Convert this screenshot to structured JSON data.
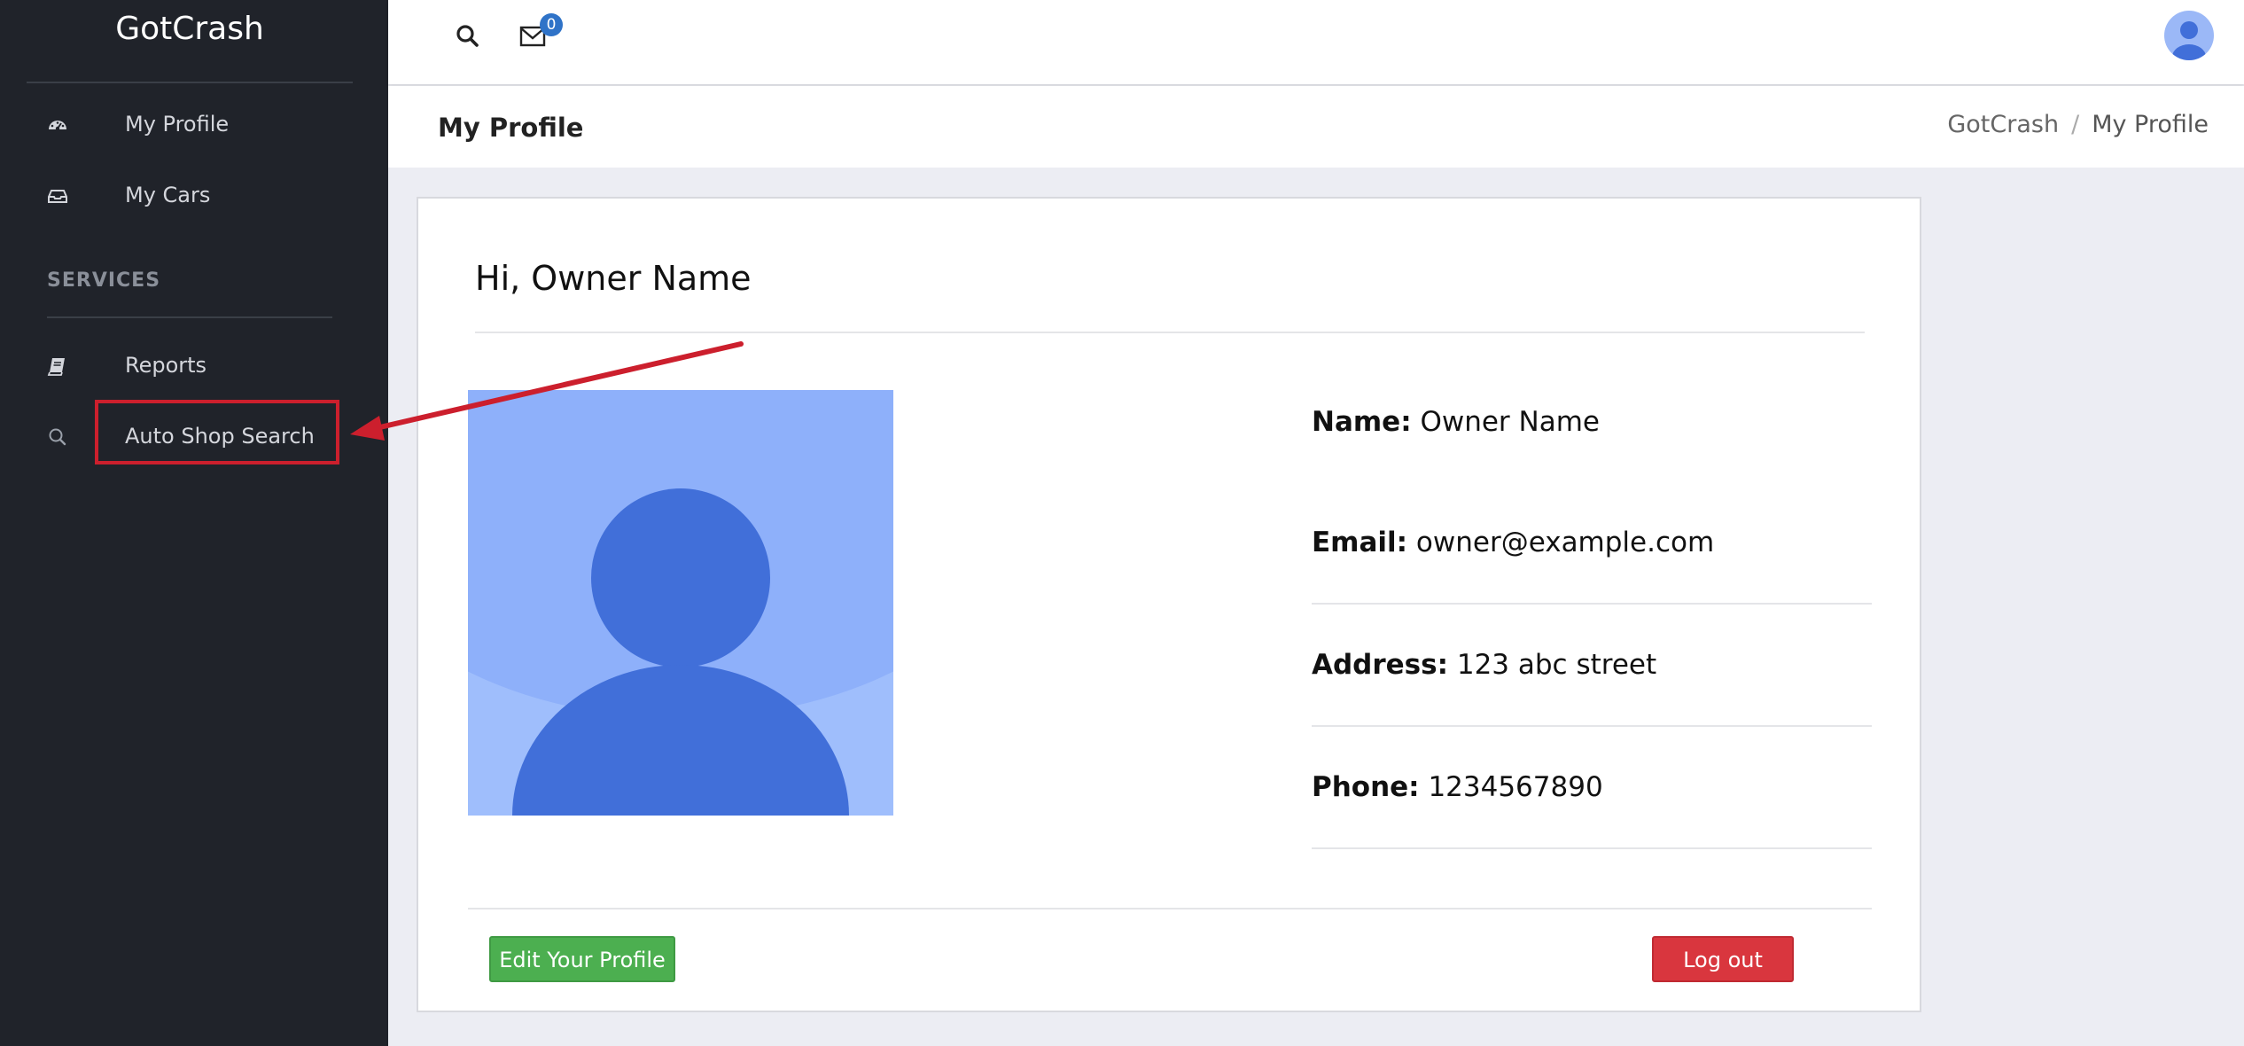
{
  "app": {
    "brand": "GotCrash"
  },
  "sidebar": {
    "items": [
      {
        "label": "My Profile",
        "icon": "dashboard-icon"
      },
      {
        "label": "My Cars",
        "icon": "inbox-icon"
      }
    ],
    "section_label": "SERVICES",
    "service_items": [
      {
        "label": "Reports",
        "icon": "book-icon"
      },
      {
        "label": "Auto Shop Search",
        "icon": "search-icon"
      }
    ]
  },
  "topbar": {
    "notification_count": "0",
    "icons": [
      "search-icon",
      "envelope-icon",
      "user-avatar"
    ]
  },
  "header": {
    "title": "My Profile",
    "breadcrumb": [
      "GotCrash",
      "My Profile"
    ],
    "breadcrumb_sep": "/"
  },
  "profile": {
    "greeting": "Hi, Owner Name",
    "fields": [
      {
        "label": "Name:",
        "value": "Owner Name"
      },
      {
        "label": "Email:",
        "value": "owner@example.com"
      },
      {
        "label": "Address:",
        "value": "123 abc street"
      },
      {
        "label": "Phone:",
        "value": "1234567890"
      }
    ],
    "edit_button": "Edit Your Profile",
    "logout_button": "Log out"
  },
  "colors": {
    "sidebar_bg": "#20232a",
    "annotation_red": "#cc1f2d",
    "edit_green": "#4caf50",
    "logout_red": "#d9363e",
    "badge_blue": "#2f73c8",
    "avatar_bg": "#9fbefc",
    "avatar_fg": "#416fd9"
  }
}
